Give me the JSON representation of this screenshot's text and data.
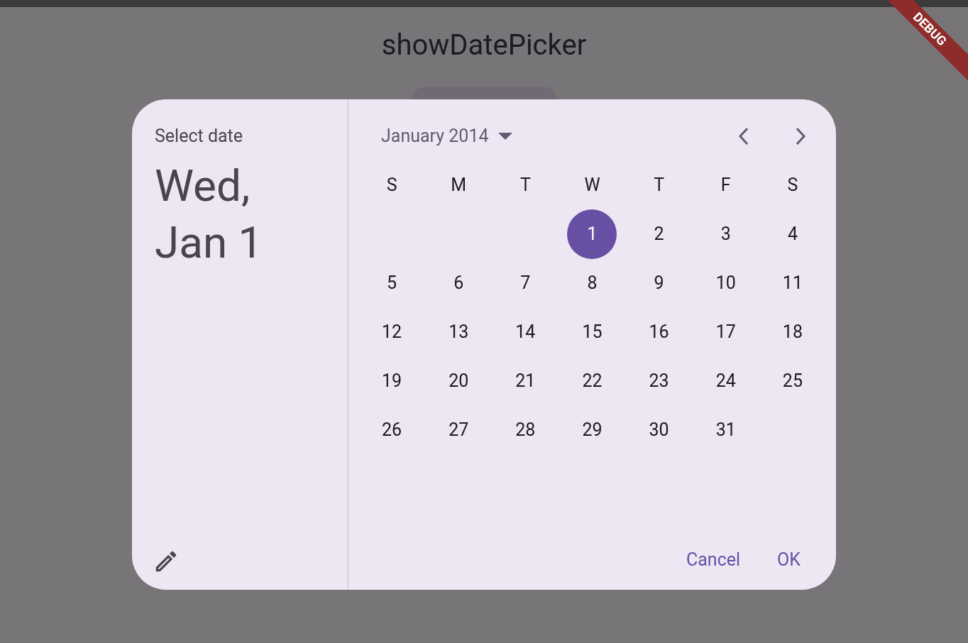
{
  "app_bar": {
    "title": "showDatePicker"
  },
  "debug_banner": "DEBUG",
  "dialog": {
    "header": "Select date",
    "selected_date": "Wed, Jan 1",
    "month_label": "January 2014",
    "weekdays": [
      "S",
      "M",
      "T",
      "W",
      "T",
      "F",
      "S"
    ],
    "weeks": [
      [
        {
          "label": "1",
          "selected": true
        },
        {
          "label": "2",
          "selected": false
        },
        {
          "label": "3",
          "selected": false
        },
        {
          "label": "4",
          "selected": false
        }
      ],
      [
        {
          "label": "5",
          "selected": false
        },
        {
          "label": "6",
          "selected": false
        },
        {
          "label": "7",
          "selected": false
        },
        {
          "label": "8",
          "selected": false
        },
        {
          "label": "9",
          "selected": false
        },
        {
          "label": "10",
          "selected": false
        },
        {
          "label": "11",
          "selected": false
        }
      ],
      [
        {
          "label": "12",
          "selected": false
        },
        {
          "label": "13",
          "selected": false
        },
        {
          "label": "14",
          "selected": false
        },
        {
          "label": "15",
          "selected": false
        },
        {
          "label": "16",
          "selected": false
        },
        {
          "label": "17",
          "selected": false
        },
        {
          "label": "18",
          "selected": false
        }
      ],
      [
        {
          "label": "19",
          "selected": false
        },
        {
          "label": "20",
          "selected": false
        },
        {
          "label": "21",
          "selected": false
        },
        {
          "label": "22",
          "selected": false
        },
        {
          "label": "23",
          "selected": false
        },
        {
          "label": "24",
          "selected": false
        },
        {
          "label": "25",
          "selected": false
        }
      ],
      [
        {
          "label": "26",
          "selected": false
        },
        {
          "label": "27",
          "selected": false
        },
        {
          "label": "28",
          "selected": false
        },
        {
          "label": "29",
          "selected": false
        },
        {
          "label": "30",
          "selected": false
        },
        {
          "label": "31",
          "selected": false
        }
      ]
    ],
    "buttons": [
      "Cancel",
      "OK"
    ]
  }
}
